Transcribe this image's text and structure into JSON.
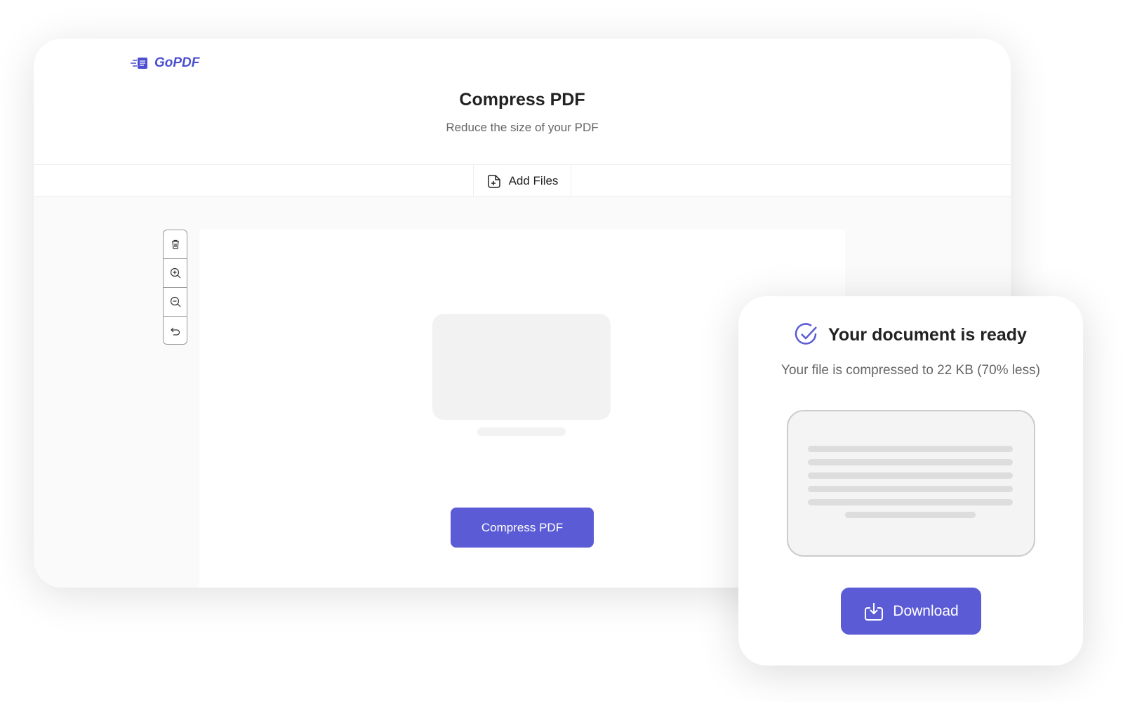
{
  "app": {
    "logo": "GoPDF",
    "title": "Compress PDF",
    "subtitle": "Reduce the size of your PDF",
    "add_files": "Add Files",
    "compress_button": "Compress PDF",
    "tools": [
      {
        "icon": "trash-icon"
      },
      {
        "icon": "zoom-in-icon"
      },
      {
        "icon": "zoom-out-icon"
      },
      {
        "icon": "undo-icon"
      }
    ]
  },
  "result": {
    "title": "Your document is ready",
    "message": "Your file is compressed to 22 KB (70% less)",
    "download": "Download"
  },
  "colors": {
    "accent": "#5b5bd6"
  }
}
